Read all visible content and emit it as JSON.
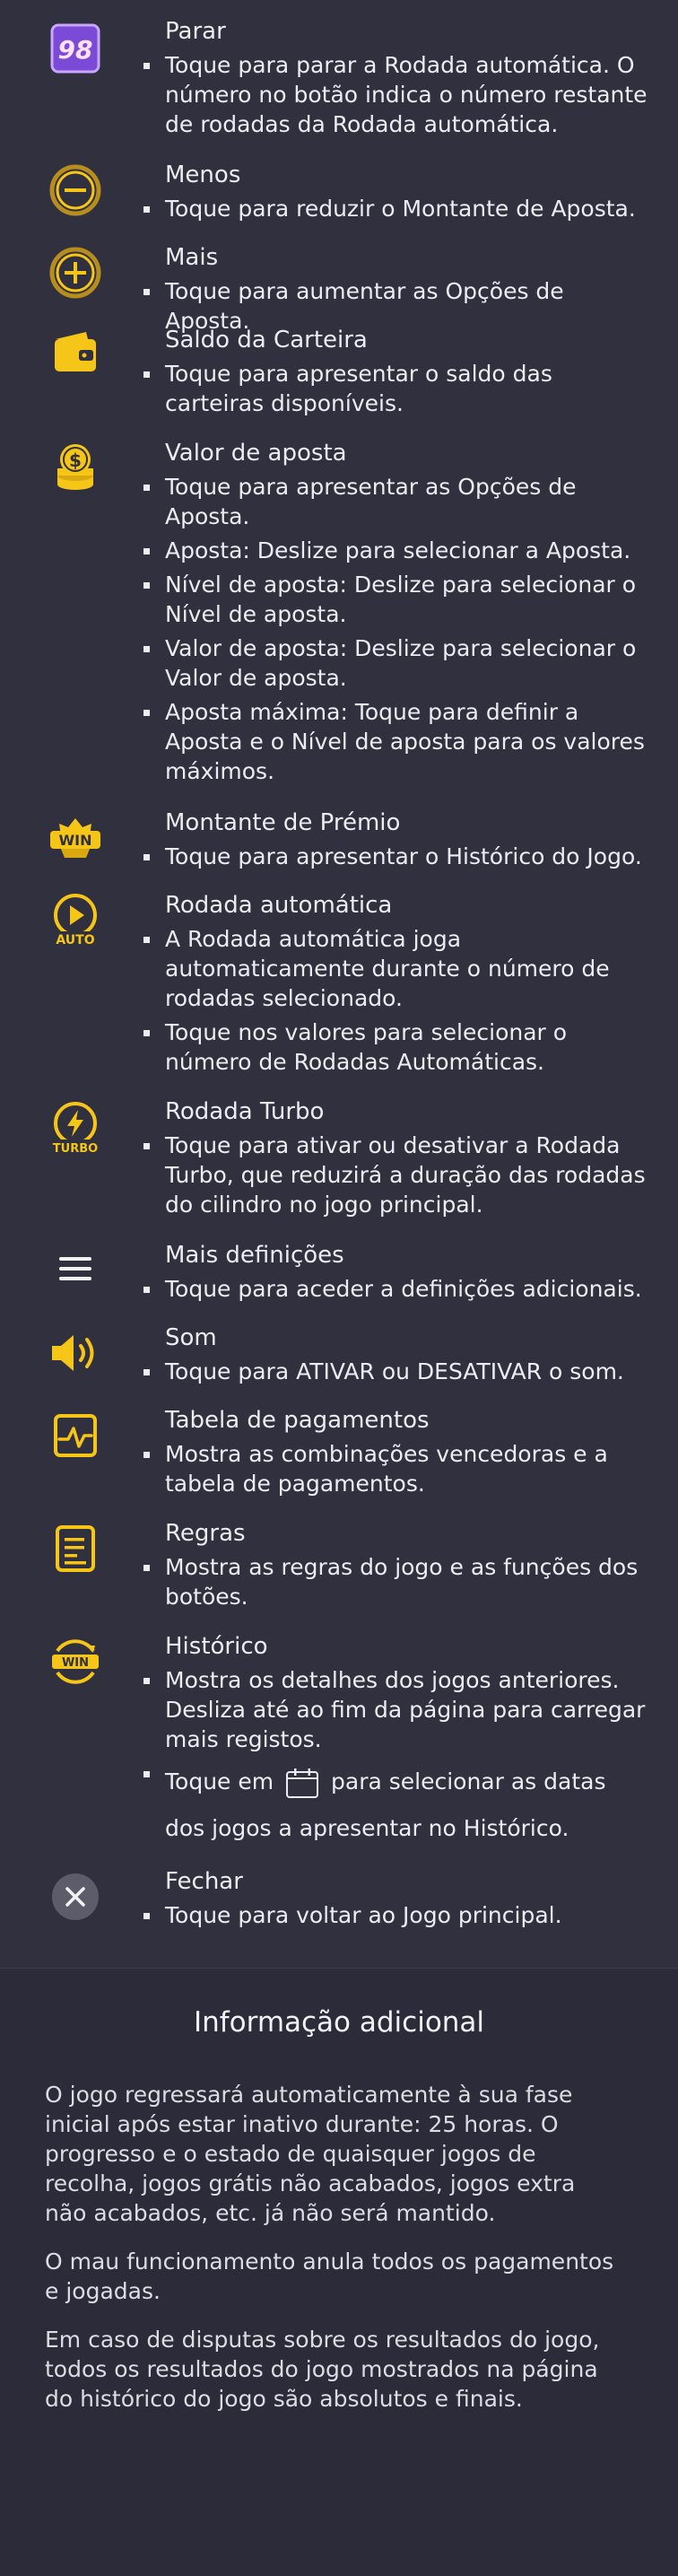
{
  "items": [
    {
      "title": "Parar",
      "icon": "stop-counter-icon",
      "icon_text": "98",
      "bullets": [
        "Toque para parar a Rodada automática. O número no botão indica o número restante de rodadas da Rodada automática."
      ]
    },
    {
      "title": "Menos",
      "icon": "minus-icon",
      "bullets": [
        "Toque para reduzir o Montante de Aposta."
      ]
    },
    {
      "title": "Mais",
      "icon": "plus-icon",
      "bullets": [
        "Toque para aumentar as Opções de Aposta."
      ]
    },
    {
      "title": "Saldo da Carteira",
      "icon": "wallet-icon",
      "bullets": [
        "Toque para apresentar o saldo das carteiras disponíveis."
      ]
    },
    {
      "title": "Valor de aposta",
      "icon": "coins-icon",
      "bullets": [
        "Toque para apresentar as Opções de Aposta.",
        "Aposta: Deslize para selecionar a Aposta.",
        "Nível de aposta: Deslize para selecionar o Nível de aposta.",
        "Valor de aposta: Deslize para selecionar o Valor de aposta.",
        "Aposta máxima: Toque para definir a Aposta e o Nível de aposta para os valores máximos."
      ]
    },
    {
      "title": "Montante de Prémio",
      "icon": "win-icon",
      "icon_text": "WIN",
      "bullets": [
        "Toque para apresentar o Histórico do Jogo."
      ]
    },
    {
      "title": "Rodada automática",
      "icon": "autoplay-icon",
      "icon_text": "AUTO",
      "bullets": [
        "A Rodada automática joga automaticamente durante o número de rodadas selecionado.",
        "Toque nos valores para selecionar o número de Rodadas Automáticas."
      ]
    },
    {
      "title": "Rodada Turbo",
      "icon": "turbo-icon",
      "icon_text": "TURBO",
      "bullets": [
        "Toque para ativar ou desativar a Rodada Turbo, que reduzirá a duração das rodadas do cilindro no jogo principal."
      ]
    },
    {
      "title": "Mais definições",
      "icon": "menu-icon",
      "bullets": [
        "Toque para aceder a definições adicionais."
      ]
    },
    {
      "title": "Som",
      "icon": "sound-icon",
      "bullets": [
        "Toque para ATIVAR ou DESATIVAR o som."
      ]
    },
    {
      "title": "Tabela de pagamentos",
      "icon": "paytable-icon",
      "bullets": [
        "Mostra as combinações vencedoras e a tabela de pagamentos."
      ]
    },
    {
      "title": "Regras",
      "icon": "rules-icon",
      "bullets": [
        "Mostra as regras do jogo e as funções dos botões."
      ]
    },
    {
      "title": "Histórico",
      "icon": "history-icon",
      "icon_text": "WIN",
      "bullets": [
        "Mostra os detalhes dos jogos anteriores. Desliza até ao fim da página para carregar mais registos."
      ],
      "bullet_calendar": {
        "before": "Toque em",
        "icon": "calendar-icon",
        "after": "para selecionar as datas dos jogos a apresentar no Histórico."
      }
    },
    {
      "title": "Fechar",
      "icon": "close-icon",
      "bullets": [
        "Toque para voltar ao Jogo principal."
      ]
    }
  ],
  "additional": {
    "heading": "Informação adicional",
    "paragraphs": [
      "O jogo regressará automaticamente à sua fase inicial após estar inativo durante: 25 horas. O progresso e o estado de quaisquer jogos de recolha, jogos grátis não acabados, jogos extra não acabados, etc. já não será mantido.",
      "O mau funcionamento anula todos os pagamentos e jogadas.",
      "Em caso de disputas sobre os resultados do jogo, todos os resultados do jogo mostrados na página do histórico do jogo são absolutos e finais."
    ]
  },
  "colors": {
    "background": "#30303f",
    "footer_background": "#2b2b3a",
    "accent_gold": "#f5c518",
    "text": "#ececf2",
    "counter_purple": "#7b4bd8",
    "close_gray": "#5c5c6b"
  }
}
